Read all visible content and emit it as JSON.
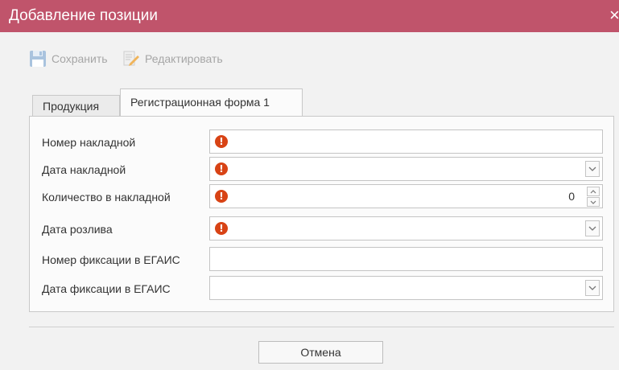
{
  "window": {
    "title": "Добавление позиции",
    "close_glyph": "×"
  },
  "toolbar": {
    "save_label": "Сохранить",
    "edit_label": "Редактировать"
  },
  "tabs": [
    {
      "label": "Продукция",
      "active": false
    },
    {
      "label": "Регистрационная форма 1",
      "active": true
    }
  ],
  "form": {
    "fields": [
      {
        "label": "Номер накладной",
        "type": "text",
        "value": "",
        "required": true
      },
      {
        "label": "Дата накладной",
        "type": "dropdown",
        "value": "",
        "required": true
      },
      {
        "label": "Количество в накладной",
        "type": "number",
        "value": "0",
        "required": true
      },
      {
        "label": "Дата розлива",
        "type": "dropdown",
        "value": "",
        "required": true
      },
      {
        "label": "Номер фиксации в ЕГАИС",
        "type": "text",
        "value": "",
        "required": false
      },
      {
        "label": "Дата фиксации в ЕГАИС",
        "type": "dropdown",
        "value": "",
        "required": false
      }
    ],
    "error_glyph": "!"
  },
  "footer": {
    "cancel_label": "Отмена"
  },
  "colors": {
    "titlebar": "#c0546b",
    "error": "#d84315",
    "disabled_text": "#a6a6a6"
  }
}
